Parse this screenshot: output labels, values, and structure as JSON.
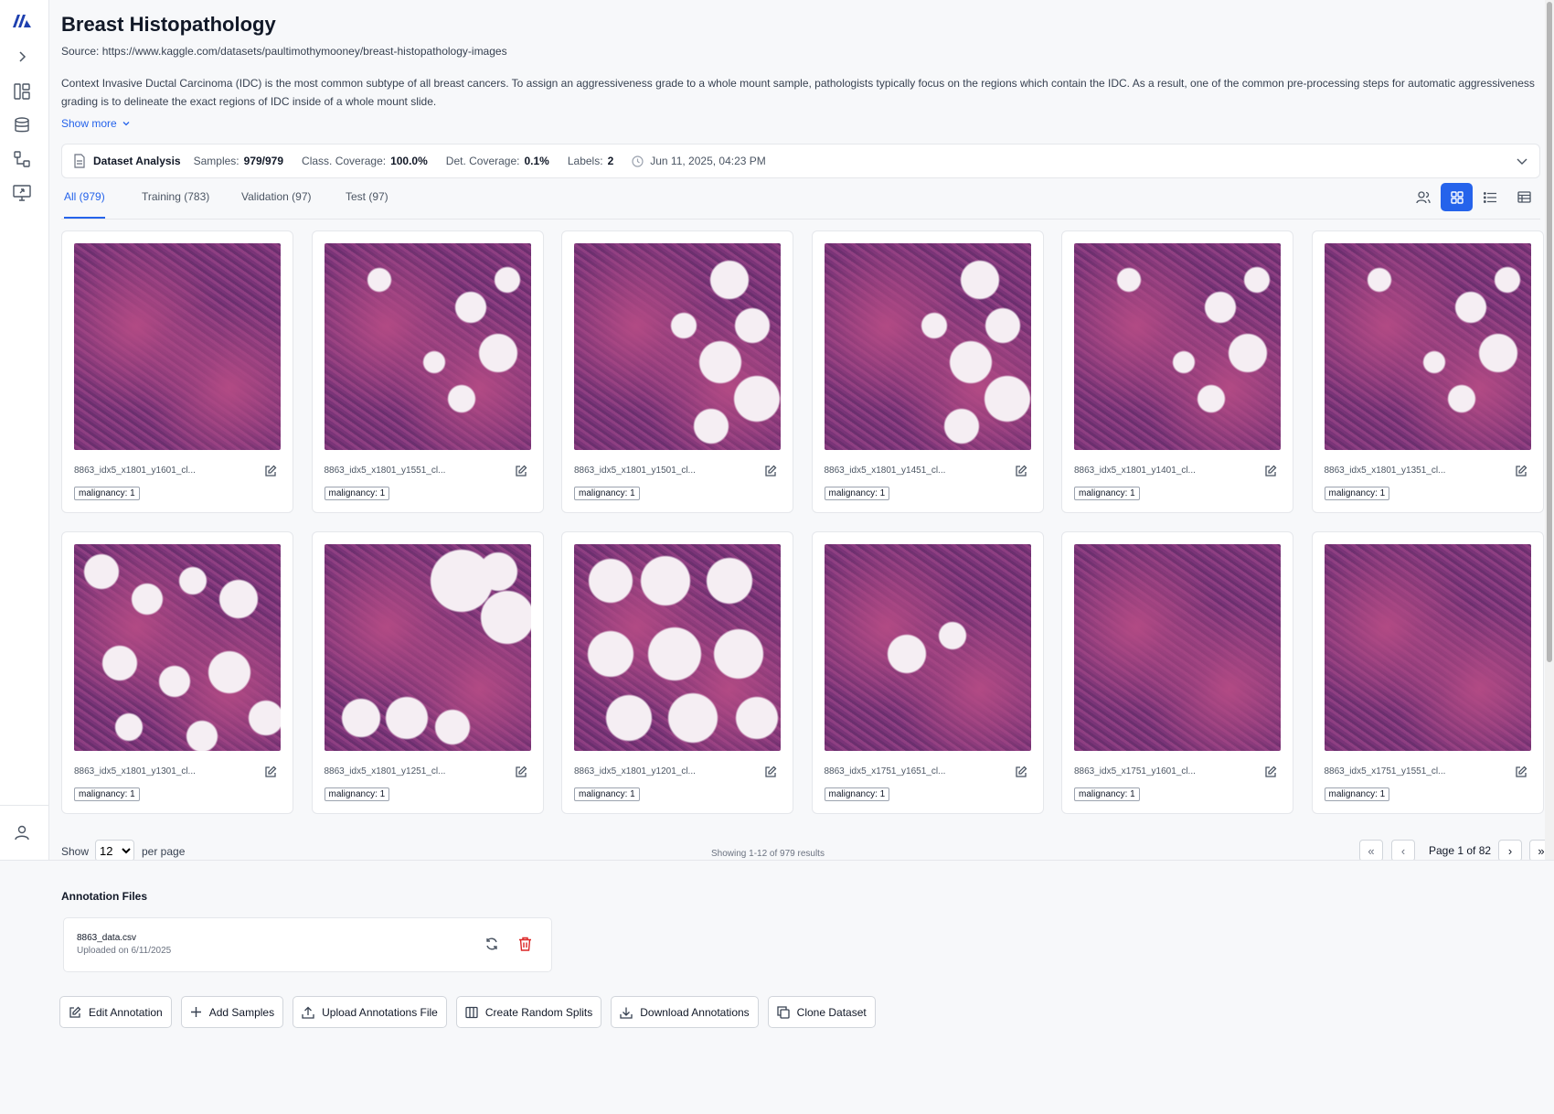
{
  "sidebar": {
    "logo_icon": "brand-logo-icon",
    "items": [
      "expand-chevron-icon",
      "dashboard-icon",
      "database-icon",
      "workflow-icon",
      "monitor-icon"
    ],
    "bottom_icon": "user-icon"
  },
  "header": {
    "title": "Breast Histopathology",
    "source": "Source: https://www.kaggle.com/datasets/paultimothymooney/breast-histopathology-images",
    "description": "Context Invasive Ductal Carcinoma (IDC) is the most common subtype of all breast cancers. To assign an aggressiveness grade to a whole mount sample, pathologists typically focus on the regions which contain the IDC. As a result, one of the common pre-processing steps for automatic aggressiveness grading is to delineate the exact regions of IDC inside of a whole mount slide.",
    "show_more": "Show more"
  },
  "analysis": {
    "title": "Dataset Analysis",
    "samples_label": "Samples:",
    "samples_value": "979/979",
    "class_cov_label": "Class. Coverage:",
    "class_cov_value": "100.0%",
    "det_cov_label": "Det. Coverage:",
    "det_cov_value": "0.1%",
    "labels_label": "Labels:",
    "labels_value": "2",
    "timestamp": "Jun 11, 2025, 04:23 PM"
  },
  "tabs": [
    {
      "label": "All (979)",
      "active": true
    },
    {
      "label": "Training (783)",
      "active": false
    },
    {
      "label": "Validation (97)",
      "active": false
    },
    {
      "label": "Test (97)",
      "active": false
    }
  ],
  "cards": [
    {
      "filename": "8863_idx5_x1801_y1601_cl...",
      "label": "malignancy: 1",
      "tissue": "dense"
    },
    {
      "filename": "8863_idx5_x1801_y1551_cl...",
      "label": "malignancy: 1",
      "tissue": "mixed"
    },
    {
      "filename": "8863_idx5_x1801_y1501_cl...",
      "label": "malignancy: 1",
      "tissue": "fatty-right"
    },
    {
      "filename": "8863_idx5_x1801_y1451_cl...",
      "label": "malignancy: 1",
      "tissue": "fatty-right"
    },
    {
      "filename": "8863_idx5_x1801_y1401_cl...",
      "label": "malignancy: 1",
      "tissue": "mixed"
    },
    {
      "filename": "8863_idx5_x1801_y1351_cl...",
      "label": "malignancy: 1",
      "tissue": "mixed"
    },
    {
      "filename": "8863_idx5_x1801_y1301_cl...",
      "label": "malignancy: 1",
      "tissue": "fatty"
    },
    {
      "filename": "8863_idx5_x1801_y1251_cl...",
      "label": "malignancy: 1",
      "tissue": "fatty-band"
    },
    {
      "filename": "8863_idx5_x1801_y1201_cl...",
      "label": "malignancy: 1",
      "tissue": "mostly-fat"
    },
    {
      "filename": "8863_idx5_x1751_y1651_cl...",
      "label": "malignancy: 1",
      "tissue": "dense-two"
    },
    {
      "filename": "8863_idx5_x1751_y1601_cl...",
      "label": "malignancy: 1",
      "tissue": "dense"
    },
    {
      "filename": "8863_idx5_x1751_y1551_cl...",
      "label": "malignancy: 1",
      "tissue": "dense"
    }
  ],
  "pagination": {
    "show_label": "Show",
    "per_page_value": "12",
    "per_page_label": "per page",
    "summary": "Showing 1-12 of 979 results",
    "page_info": "Page 1 of 82"
  },
  "annotation_files": {
    "title": "Annotation Files",
    "file": {
      "name": "8863_data.csv",
      "uploaded": "Uploaded on 6/11/2025"
    }
  },
  "actions": [
    {
      "label": "Edit Annotation",
      "icon": "edit-icon"
    },
    {
      "label": "Add Samples",
      "icon": "plus-icon"
    },
    {
      "label": "Upload Annotations File",
      "icon": "upload-icon"
    },
    {
      "label": "Create Random Splits",
      "icon": "columns-icon"
    },
    {
      "label": "Download Annotations",
      "icon": "download-icon"
    },
    {
      "label": "Clone Dataset",
      "icon": "copy-icon"
    }
  ],
  "colors": {
    "accent": "#2563eb",
    "danger": "#dc2626",
    "tissue_dark": "#6b2f6e",
    "tissue_pink": "#b24a84",
    "fat": "#f5eef3"
  }
}
